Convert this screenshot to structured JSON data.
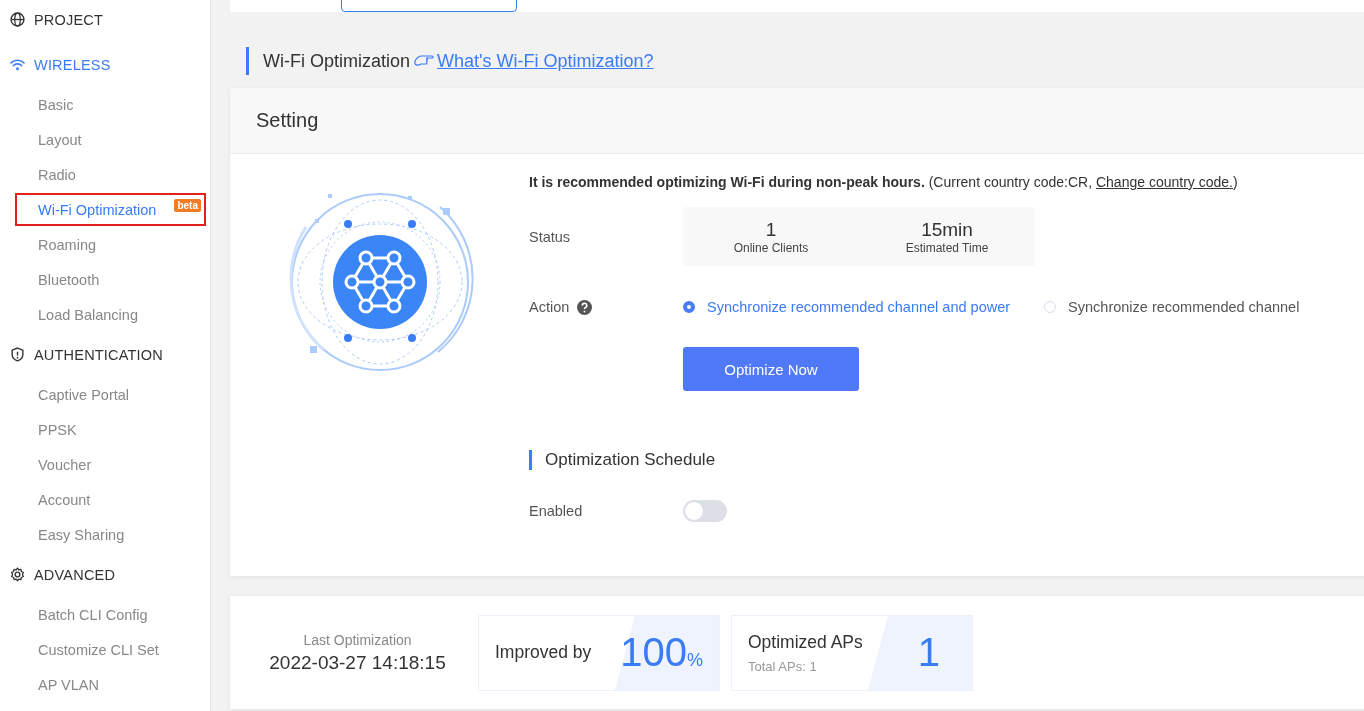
{
  "sidebar": {
    "sections": [
      {
        "label": "PROJECT",
        "kind": "globe",
        "selected": false
      },
      {
        "label": "WIRELESS",
        "kind": "wifi",
        "selected": true,
        "items": [
          {
            "label": "Basic",
            "selected": false
          },
          {
            "label": "Layout",
            "selected": false
          },
          {
            "label": "Radio",
            "selected": false
          },
          {
            "label": "Wi-Fi Optimization",
            "selected": true,
            "badge": "beta",
            "highlighted": true
          },
          {
            "label": "Roaming",
            "selected": false
          },
          {
            "label": "Bluetooth",
            "selected": false
          },
          {
            "label": "Load Balancing",
            "selected": false
          }
        ]
      },
      {
        "label": "AUTHENTICATION",
        "kind": "shield",
        "selected": false,
        "items": [
          {
            "label": "Captive Portal",
            "selected": false
          },
          {
            "label": "PPSK",
            "selected": false
          },
          {
            "label": "Voucher",
            "selected": false
          },
          {
            "label": "Account",
            "selected": false
          },
          {
            "label": "Easy Sharing",
            "selected": false
          }
        ]
      },
      {
        "label": "ADVANCED",
        "kind": "gear",
        "selected": false,
        "items": [
          {
            "label": "Batch CLI Config",
            "selected": false
          },
          {
            "label": "Customize CLI Set",
            "selected": false
          },
          {
            "label": "AP VLAN",
            "selected": false
          }
        ]
      }
    ]
  },
  "page_heading": {
    "title": "Wi-Fi Optimization",
    "help_link": "What's Wi-Fi Optimization?"
  },
  "setting": {
    "title": "Setting",
    "intro": {
      "text": "**It is recommended optimizing Wi-Fi during non-peak hours.** (Current country code:CR, ",
      "link": "Change country code.",
      "suffix": ")"
    },
    "status": {
      "label": "Status",
      "stats": [
        {
          "value": "1",
          "caption": "Online Clients"
        },
        {
          "value": "15min",
          "caption": "Estimated Time"
        }
      ]
    },
    "action": {
      "label": "Action",
      "options": [
        {
          "label": "Synchronize recommended channel and power",
          "selected": true
        },
        {
          "label": "Synchronize recommended channel",
          "selected": false
        }
      ]
    },
    "button": "Optimize Now",
    "schedule": {
      "title": "Optimization Schedule",
      "label": "Enabled",
      "enabled": false
    }
  },
  "summary": {
    "last_label": "Last Optimization",
    "last_time": "2022-03-27 14:18:15",
    "improved": {
      "label": "Improved by",
      "value": "100",
      "unit": "%"
    },
    "aps": {
      "label": "Optimized APs",
      "sub": "Total APs: 1",
      "value": "1"
    }
  }
}
